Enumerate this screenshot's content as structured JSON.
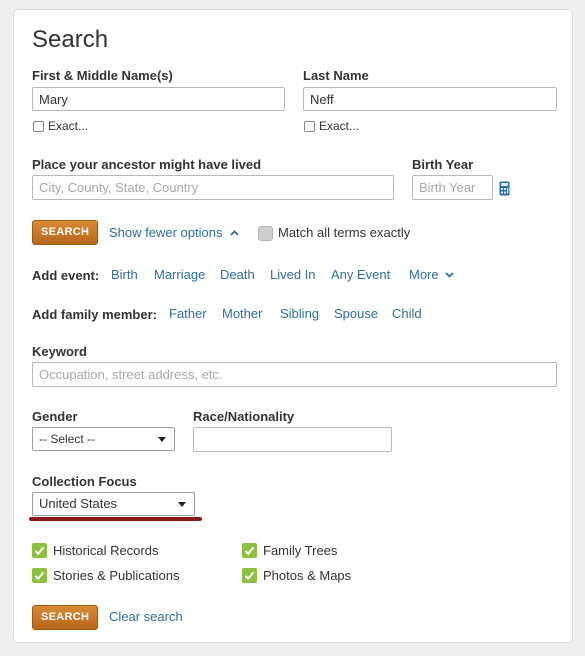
{
  "search": {
    "title": "Search",
    "first_name": {
      "label": "First & Middle Name(s)",
      "value": "Mary",
      "exact_label": "Exact..."
    },
    "last_name": {
      "label": "Last Name",
      "value": "Neff",
      "exact_label": "Exact..."
    },
    "place": {
      "label": "Place your ancestor might have lived",
      "placeholder": "City, County, State, Country"
    },
    "birth_year": {
      "label": "Birth Year",
      "placeholder": "Birth Year"
    },
    "search_button": "SEARCH",
    "show_fewer": "Show fewer options",
    "match_all": "Match all terms exactly",
    "add_event": {
      "label": "Add event:",
      "items": [
        "Birth",
        "Marriage",
        "Death",
        "Lived In",
        "Any Event"
      ],
      "more": "More"
    },
    "add_family": {
      "label": "Add family member:",
      "items": [
        "Father",
        "Mother",
        "Sibling",
        "Spouse",
        "Child"
      ]
    },
    "keyword": {
      "label": "Keyword",
      "placeholder": "Occupation, street address, etc."
    },
    "gender": {
      "label": "Gender",
      "selected": "-- Select --"
    },
    "race": {
      "label": "Race/Nationality",
      "value": ""
    },
    "collection_focus": {
      "label": "Collection Focus",
      "selected": "United States"
    },
    "categories": [
      "Historical Records",
      "Family Trees",
      "Stories & Publications",
      "Photos & Maps"
    ],
    "bottom_search_button": "SEARCH",
    "clear_search": "Clear search"
  },
  "colors": {
    "accent_button": "#c9792a",
    "link": "#2c6e9c",
    "check_green": "#8cc13f",
    "underline_annotation": "#8b1a1a"
  },
  "icons": {
    "birth_year_helper": "calculator-icon",
    "show_fewer": "chevron-up-icon",
    "more": "chevron-down-icon",
    "select_arrow": "caret-down-icon",
    "category_check": "checkmark-icon"
  }
}
